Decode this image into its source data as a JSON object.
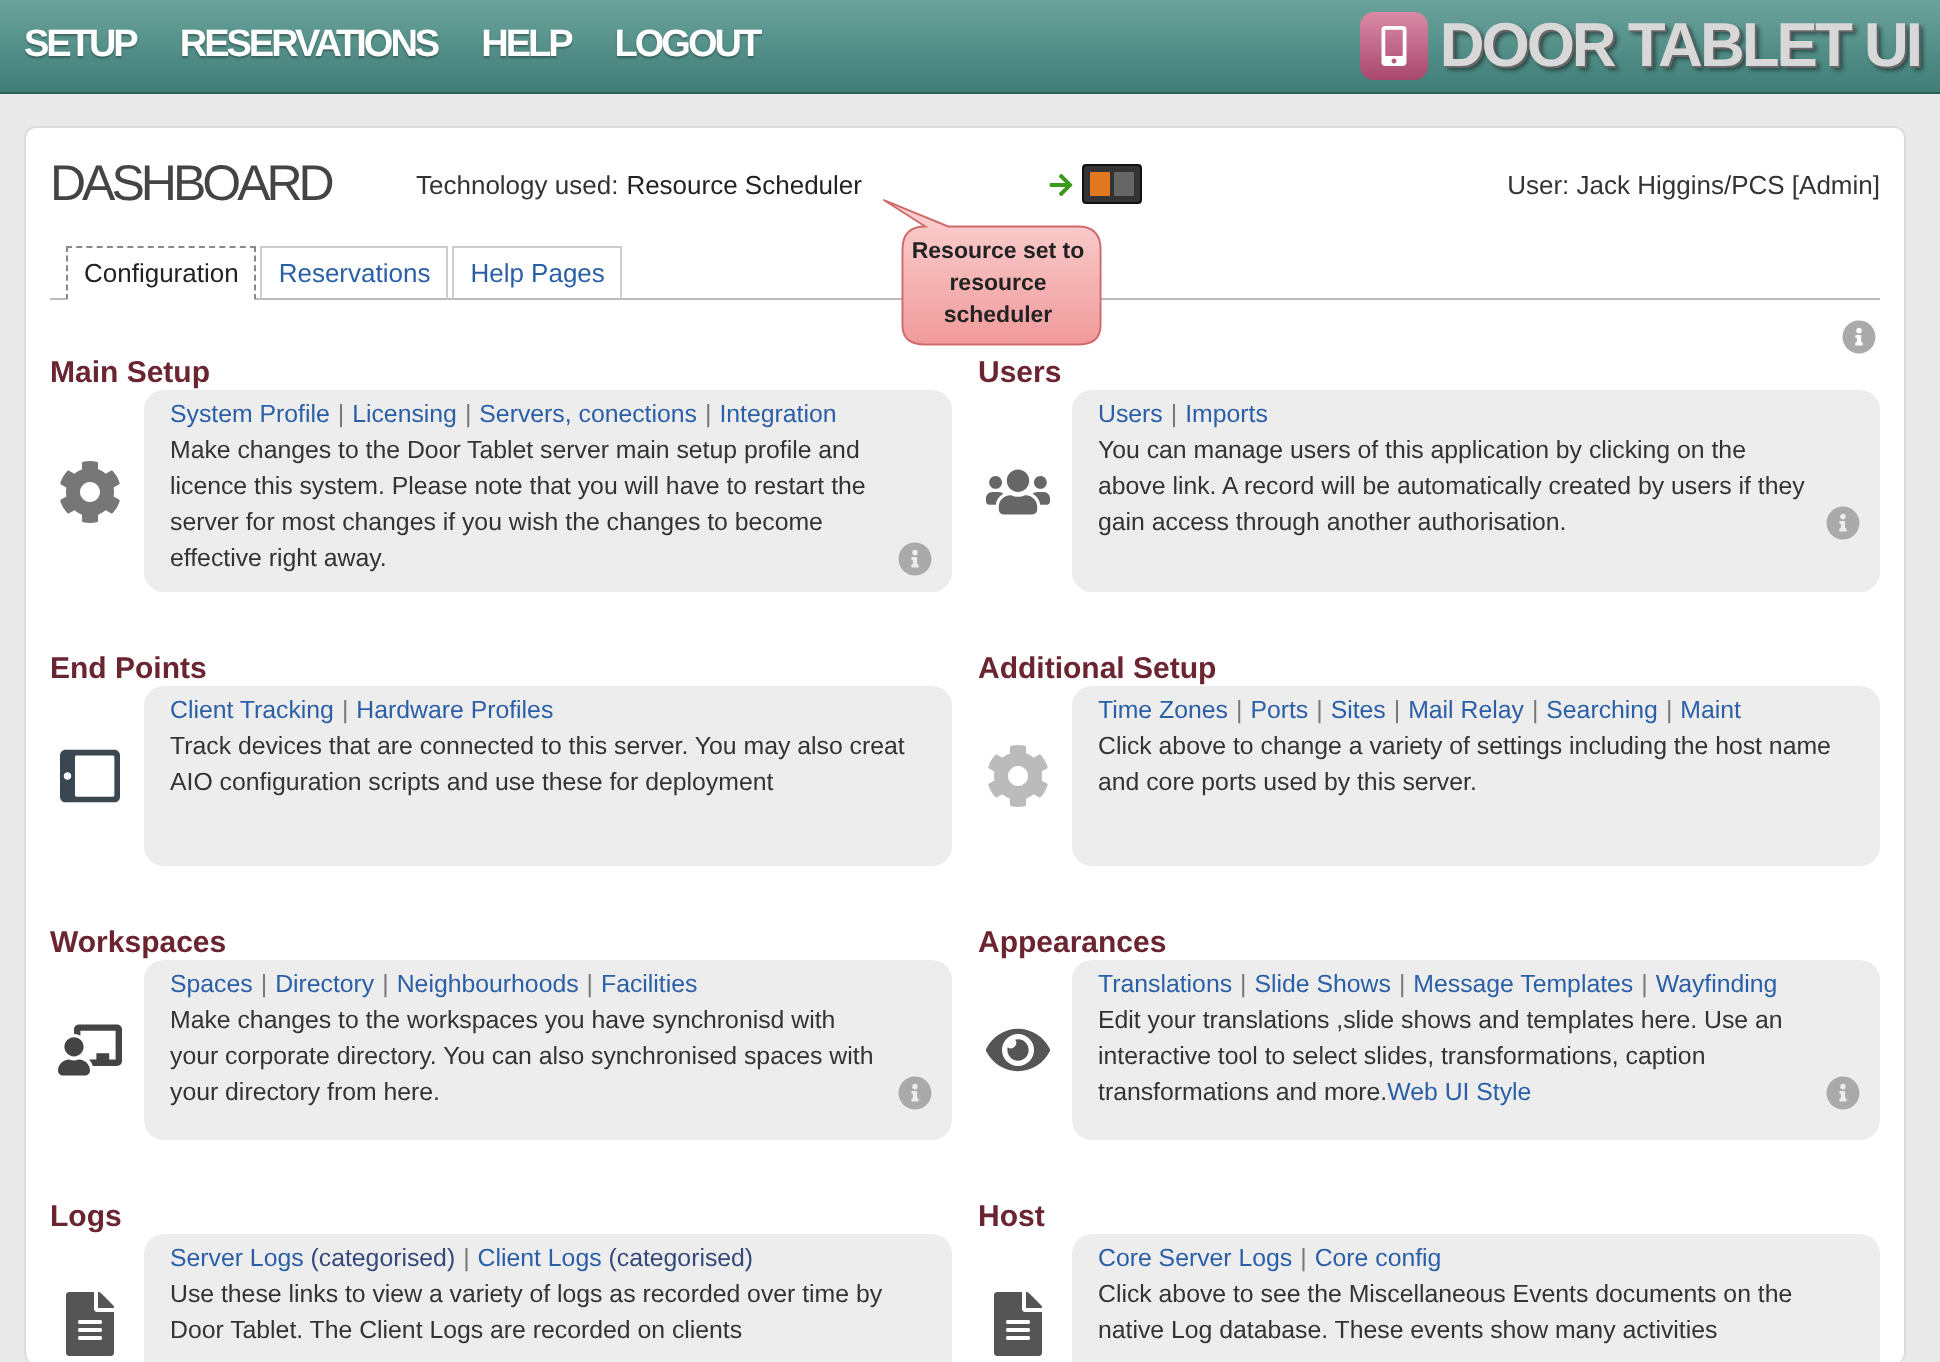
{
  "nav": [
    {
      "label": "SETUP"
    },
    {
      "label": "RESERVATIONS"
    },
    {
      "label": "HELP"
    },
    {
      "label": "LOGOUT"
    }
  ],
  "logo": {
    "text": "DOOR TABLET UI"
  },
  "dashboard": {
    "title": "DASHBOARD",
    "technology_label": "Technology used:",
    "technology_value": "Resource Scheduler",
    "user": "User: Jack Higgins/PCS [Admin]"
  },
  "callout": {
    "text": "Resource set to resource scheduler"
  },
  "tabs": [
    {
      "label": "Configuration",
      "selected": true
    },
    {
      "label": "Reservations",
      "selected": false
    },
    {
      "label": "Help Pages",
      "selected": false
    }
  ],
  "sections": [
    {
      "title": "Main Setup",
      "kind": "gear",
      "info": true,
      "links": [
        {
          "label": "System Profile"
        },
        {
          "separator": "|",
          "label": "Licensing"
        },
        {
          "separator": "|",
          "label": "Servers, conections"
        },
        {
          "separator": "|",
          "label": "Integration"
        }
      ],
      "description": "Make changes to the Door Tablet server main setup profile and licence this system. Please note that you will have to restart the server for most changes if you wish the changes to become effective right away."
    },
    {
      "title": "Users",
      "kind": "users",
      "info": true,
      "links": [
        {
          "label": "Users"
        },
        {
          "separator": "|",
          "label": "Imports"
        }
      ],
      "description": "You can manage users of this application by clicking on the above link. A record will be automatically created by users if they gain access through another authorisation."
    },
    {
      "title": "End Points",
      "kind": "tablet",
      "info": false,
      "links": [
        {
          "label": "Client Tracking"
        },
        {
          "separator": "|",
          "label": "Hardware Profiles"
        }
      ],
      "description": "Track devices that are connected to this server.  You may also creat AIO configuration scripts and use these for deployment"
    },
    {
      "title": "Additional Setup",
      "kind": "gear-light",
      "info": false,
      "links": [
        {
          "label": "Time Zones"
        },
        {
          "separator": "|",
          "label": "Ports"
        },
        {
          "separator": "|",
          "label": "Sites"
        },
        {
          "separator": "|",
          "label": "Mail Relay"
        },
        {
          "separator": "|",
          "label": "Searching"
        },
        {
          "separator": "|",
          "label": "Maint"
        }
      ],
      "description": "Click above to change a variety of settings including the host name and core ports used by this server."
    },
    {
      "title": "Workspaces",
      "kind": "audience",
      "info": true,
      "links": [
        {
          "label": "Spaces"
        },
        {
          "separator": "|",
          "label": "Directory"
        },
        {
          "separator": "|",
          "label": "Neighbourhoods"
        },
        {
          "separator": "|",
          "label": "Facilities"
        }
      ],
      "description": "Make changes to the workspaces you have synchronisd with your corporate directory. You can also synchronised spaces with your directory from here."
    },
    {
      "title": "Appearances",
      "kind": "eye",
      "info": true,
      "links": [
        {
          "label": "Translations"
        },
        {
          "separator": "|",
          "label": "Slide Shows"
        },
        {
          "separator": "|",
          "label": "Message Templates"
        },
        {
          "separator": "|",
          "label": "Wayfinding"
        }
      ],
      "description": "Edit your translations ,slide shows and templates here. Use an interactive tool to select slides, transformations, caption transformations and more.",
      "inline_link": "Web UI Style"
    },
    {
      "title": "Logs",
      "kind": "document",
      "info": false,
      "links": [
        {
          "label": "Server Logs",
          "suffix": "(categorised)"
        },
        {
          "separator": "|",
          "label": "Client Logs",
          "suffix": "(categorised)"
        }
      ],
      "description": "Use these links to view a variety of logs as recorded over time by Door Tablet. The Client Logs are recorded on clients"
    },
    {
      "title": "Host",
      "kind": "document",
      "info": false,
      "links": [
        {
          "label": "Core Server Logs"
        },
        {
          "separator": "|",
          "label": "Core config"
        }
      ],
      "description": "Click above to see the Miscellaneous Events documents on the native Log database. These events show many activities"
    }
  ]
}
